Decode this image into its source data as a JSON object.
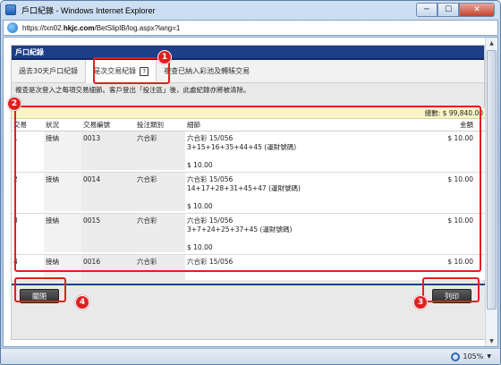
{
  "window": {
    "title": "戶口紀錄 - Windows Internet Explorer",
    "url_prefix": "https://txn02.",
    "url_domain": "hkjc.com",
    "url_path": "/BetSlipIB/log.aspx?lang=1",
    "min_glyph": "─",
    "max_glyph": "☐",
    "close_glyph": "✕"
  },
  "page": {
    "header": "戶口紀錄",
    "tabs": [
      {
        "label": "過去30天戶口紀錄"
      },
      {
        "label": "是次交易紀錄",
        "help": "?"
      },
      {
        "label": "複查已納入彩池及轉賬交易"
      }
    ],
    "notice": "複查是次登入之每項交易細節。客戶登出「投注區」後，此處紀錄亦將被清除。",
    "total": "總數: $ 99,840.00",
    "columns": [
      "交易",
      "狀況",
      "交易編號",
      "投注類別",
      "細節",
      "金額"
    ],
    "rows": [
      {
        "idx": "1",
        "status": "接納",
        "ref": "0013",
        "type": "六合彩",
        "line1": "六合彩 15/056",
        "line2": "3+15+16+35+44+45 (運財號碼)",
        "line3": "",
        "unit": "$ 10.00",
        "amount": "$ 10.00"
      },
      {
        "idx": "2",
        "status": "接納",
        "ref": "0014",
        "type": "六合彩",
        "line1": "六合彩 15/056",
        "line2": "14+17+28+31+45+47 (運財號碼)",
        "line3": "",
        "unit": "$ 10.00",
        "amount": "$ 10.00"
      },
      {
        "idx": "3",
        "status": "接納",
        "ref": "0015",
        "type": "六合彩",
        "line1": "六合彩 15/056",
        "line2": "3+7+24+25+37+45 (運財號碼)",
        "line3": "",
        "unit": "$ 10.00",
        "amount": "$ 10.00"
      },
      {
        "idx": "4",
        "status": "接納",
        "ref": "0016",
        "type": "六合彩",
        "line1": "六合彩 15/056",
        "line2": "",
        "line3": "",
        "unit": "",
        "amount": "$ 10.00"
      }
    ],
    "close_button": "關閉",
    "print_button": "列印"
  },
  "annotations": [
    "1",
    "2",
    "3",
    "4"
  ],
  "statusbar": {
    "zoom": "105%"
  },
  "colors": {
    "header": "#1d3f88",
    "annotation": "#e02020",
    "total_bg": "#f8f4c6"
  }
}
